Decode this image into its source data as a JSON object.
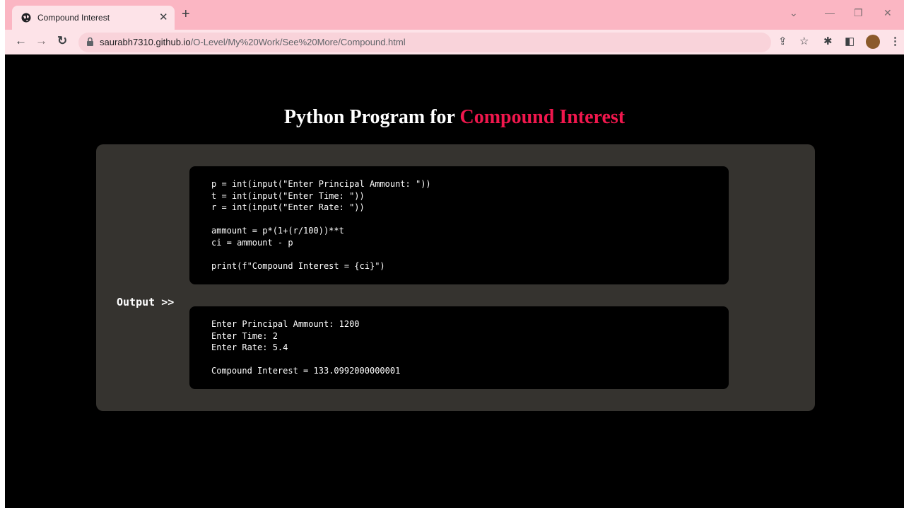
{
  "browser": {
    "tab_title": "Compound Interest",
    "url_host": "saurabh7310.github.io",
    "url_path": "/O-Level/My%20Work/See%20More/Compound.html"
  },
  "page": {
    "title_prefix": "Python Program for ",
    "title_accent": "Compound Interest",
    "source_code": "p = int(input(\"Enter Principal Ammount: \"))\nt = int(input(\"Enter Time: \"))\nr = int(input(\"Enter Rate: \"))\n\nammount = p*(1+(r/100))**t\nci = ammount - p\n\nprint(f\"Compound Interest = {ci}\")",
    "output_label": "Output >>",
    "output_text": "Enter Principal Ammount: 1200\nEnter Time: 2\nEnter Rate: 5.4\n\nCompound Interest = 133.0992000000001"
  },
  "colors": {
    "accent": "#f0174d",
    "panel": "#35332f",
    "chrome": "#fbb6c3"
  }
}
